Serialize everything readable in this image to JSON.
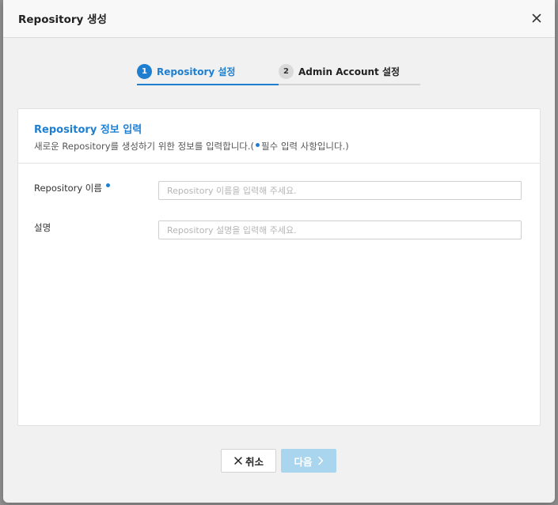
{
  "modal": {
    "title": "Repository 생성",
    "close_icon": "close-icon"
  },
  "steps": [
    {
      "number": "1",
      "label": "Repository 설정",
      "active": true
    },
    {
      "number": "2",
      "label": "Admin Account 설정",
      "active": false
    }
  ],
  "card": {
    "title": "Repository 정보 입력",
    "desc_prefix": "새로운 Repository를 생성하기 위한 정보를 입력합니다.(",
    "desc_suffix": "필수 입력 사항입니다.)"
  },
  "form": {
    "name_label": "Repository 이름",
    "name_placeholder": "Repository 이름을 입력해 주세요.",
    "name_value": "",
    "desc_label": "설명",
    "desc_placeholder": "Repository 설명을 입력해 주세요.",
    "desc_value": ""
  },
  "footer": {
    "cancel_label": "취소",
    "next_label": "다음",
    "cancel_icon": "close-icon",
    "next_icon": "chevron-right-icon"
  },
  "colors": {
    "accent": "#1e7fd1",
    "disabled_button": "#a9d5ef"
  }
}
